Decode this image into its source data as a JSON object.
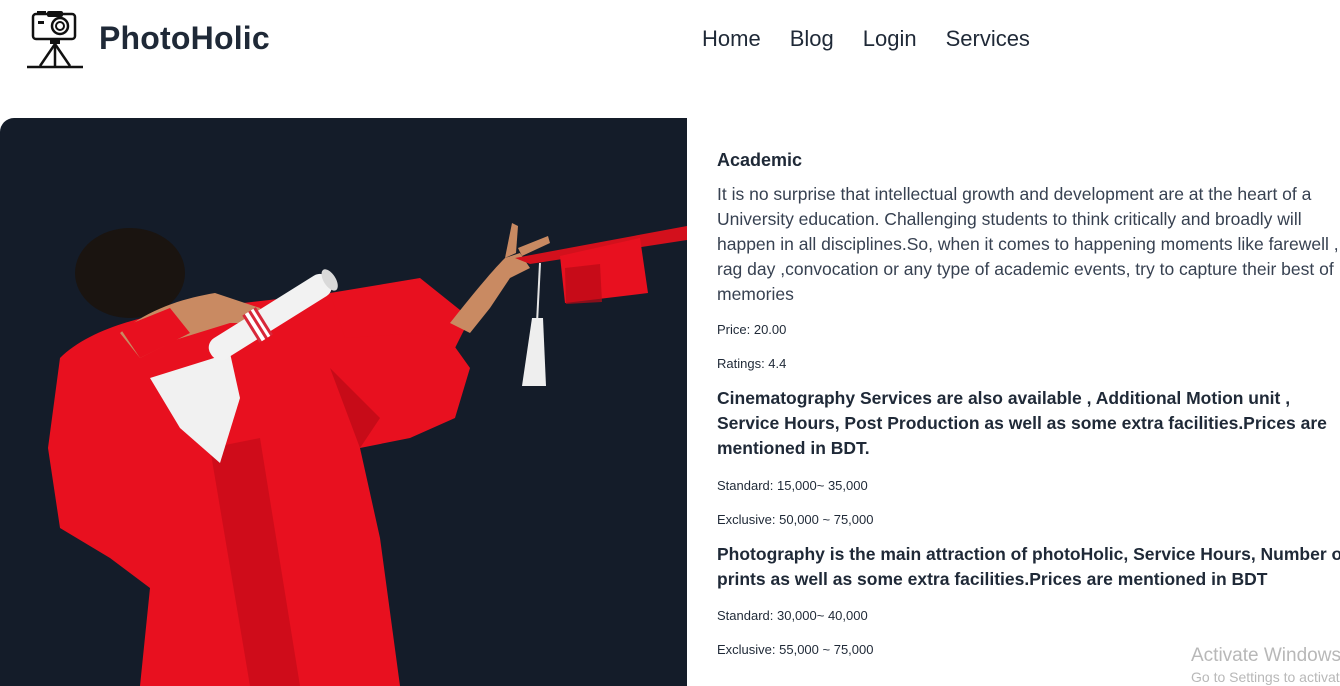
{
  "header": {
    "brand": "PhotoHolic",
    "logo_icon": "camera-tripod-icon",
    "nav": [
      {
        "label": "Home"
      },
      {
        "label": "Blog"
      },
      {
        "label": "Login"
      },
      {
        "label": "Services"
      }
    ]
  },
  "hero": {
    "background_color": "#141c29",
    "gown_color": "#e8101f"
  },
  "service": {
    "title": "Academic",
    "description": "It is no surprise that intellectual growth and development are at the heart of a University education. Challenging students to think critically and broadly will happen in all disciplines.So, when it comes to happening moments like farewell , rag day ,convocation or any type of academic events, try to capture their best of memories",
    "price": "Price: 20.00",
    "ratings": "Ratings: 4.4",
    "cinematography": {
      "text": "Cinematography Services are also available , Additional Motion unit , Service Hours, Post Production as well as some extra facilities.Prices are mentioned in BDT.",
      "standard": "Standard: 15,000~ 35,000",
      "exclusive": "Exclusive: 50,000 ~ 75,000"
    },
    "photography": {
      "text": "Photography is the main attraction of photoHolic, Service Hours, Number of prints as well as some extra facilities.Prices are mentioned in BDT",
      "standard": "Standard: 30,000~ 40,000",
      "exclusive": "Exclusive: 55,000 ~ 75,000"
    }
  },
  "watermark": {
    "line1": "Activate Windows",
    "line2": "Go to Settings to activate Windows."
  }
}
